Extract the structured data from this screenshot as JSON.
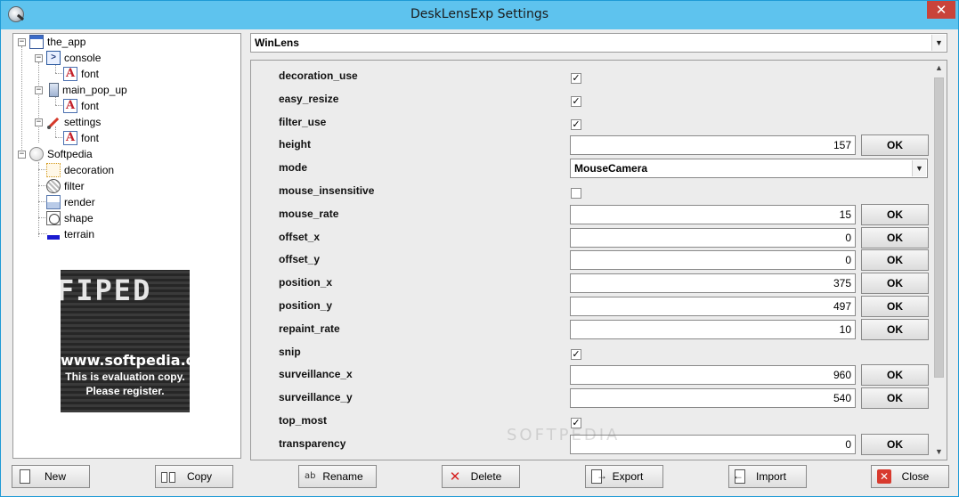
{
  "window": {
    "title": "DeskLensExp Settings",
    "close_glyph": "✕"
  },
  "tree": {
    "items": [
      {
        "label": "the_app",
        "icon": "window-icon"
      },
      {
        "label": "console",
        "icon": "console-icon"
      },
      {
        "label": "font",
        "icon": "font-icon"
      },
      {
        "label": "main_pop_up",
        "icon": "popup-icon"
      },
      {
        "label": "font",
        "icon": "font-icon"
      },
      {
        "label": "settings",
        "icon": "settings-icon"
      },
      {
        "label": "font",
        "icon": "font-icon"
      },
      {
        "label": "Softpedia",
        "icon": "globe-icon"
      },
      {
        "label": "decoration",
        "icon": "decoration-icon"
      },
      {
        "label": "filter",
        "icon": "filter-icon"
      },
      {
        "label": "render",
        "icon": "render-icon"
      },
      {
        "label": "shape",
        "icon": "shape-icon"
      },
      {
        "label": "terrain",
        "icon": "terrain-icon"
      }
    ],
    "expander_minus": "−",
    "evaluation": {
      "logo_text": "FIPED",
      "url": "www.softpedia.com",
      "line1": "This is evaluation copy.",
      "line2": "Please register."
    }
  },
  "selector": {
    "value": "WinLens",
    "arrow": "▼"
  },
  "properties": {
    "check_mark": "✓",
    "ok_label": "OK",
    "combo_arrow": "▼",
    "rows": [
      {
        "label": "decoration_use",
        "type": "checkbox",
        "checked": true
      },
      {
        "label": "easy_resize",
        "type": "checkbox",
        "checked": true
      },
      {
        "label": "filter_use",
        "type": "checkbox",
        "checked": true
      },
      {
        "label": "height",
        "type": "number",
        "value": "157"
      },
      {
        "label": "mode",
        "type": "select",
        "value": "MouseCamera"
      },
      {
        "label": "mouse_insensitive",
        "type": "checkbox",
        "checked": false
      },
      {
        "label": "mouse_rate",
        "type": "number",
        "value": "15"
      },
      {
        "label": "offset_x",
        "type": "number",
        "value": "0"
      },
      {
        "label": "offset_y",
        "type": "number",
        "value": "0"
      },
      {
        "label": "position_x",
        "type": "number",
        "value": "375"
      },
      {
        "label": "position_y",
        "type": "number",
        "value": "497"
      },
      {
        "label": "repaint_rate",
        "type": "number",
        "value": "10"
      },
      {
        "label": "snip",
        "type": "checkbox",
        "checked": true
      },
      {
        "label": "surveillance_x",
        "type": "number",
        "value": "960"
      },
      {
        "label": "surveillance_y",
        "type": "number",
        "value": "540"
      },
      {
        "label": "top_most",
        "type": "checkbox",
        "checked": true
      },
      {
        "label": "transparency",
        "type": "number",
        "value": "0"
      }
    ],
    "scroll_up": "▲",
    "scroll_down": "▼",
    "watermark": "SOFTPEDIA"
  },
  "buttons": {
    "new": "New",
    "copy": "Copy",
    "rename": "Rename",
    "delete": "Delete",
    "export": "Export",
    "import": "Import",
    "close": "Close",
    "rename_icon": "ab",
    "delete_icon": "✕",
    "close_icon": "✕"
  },
  "colors": {
    "titlebar": "#5ec3ee",
    "close_button": "#c9433a",
    "window_border": "#1e9ad6"
  }
}
